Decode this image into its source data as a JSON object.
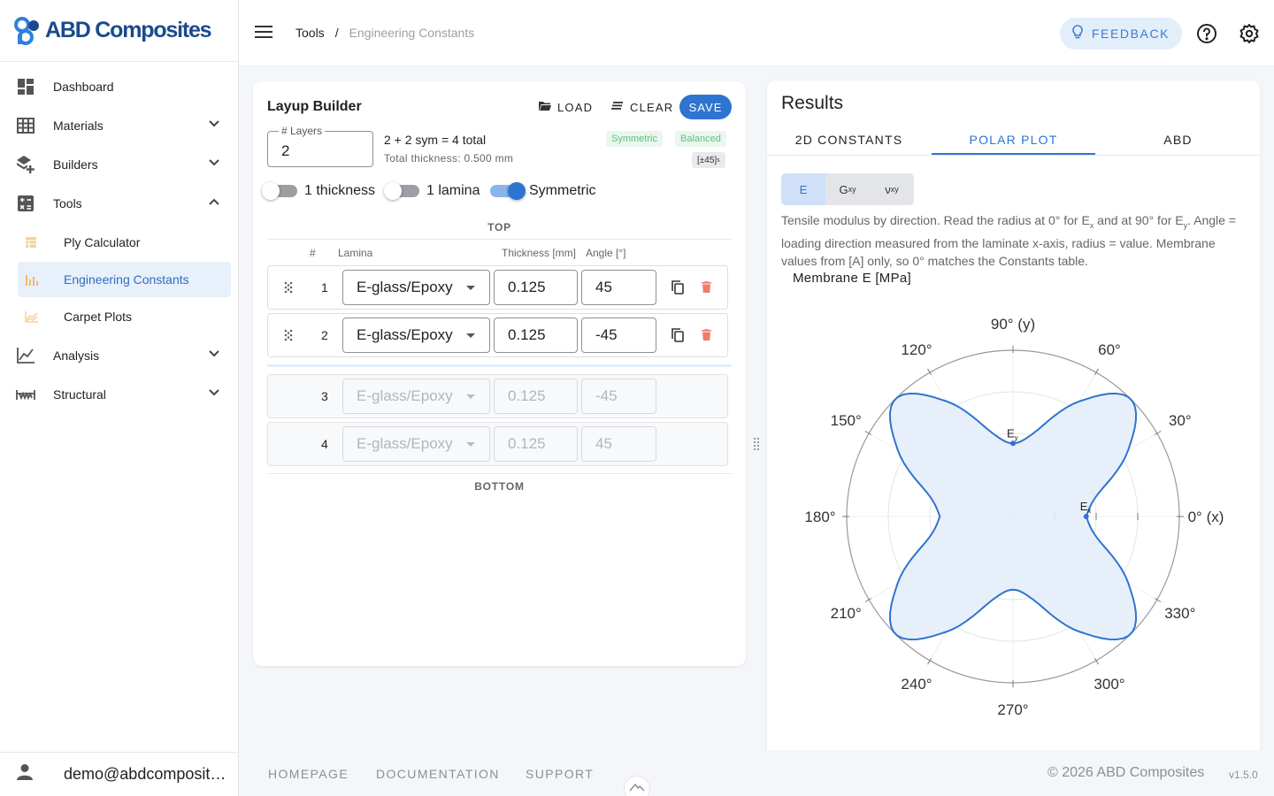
{
  "app": {
    "brand": "ABD Composites"
  },
  "sidebar": {
    "items": [
      {
        "label": "Dashboard",
        "icon": "dashboard-icon"
      },
      {
        "label": "Materials",
        "icon": "grid-icon"
      },
      {
        "label": "Builders",
        "icon": "layers-add-icon"
      },
      {
        "label": "Tools",
        "icon": "calculator-icon"
      },
      {
        "label": "Analysis",
        "icon": "line-chart-icon"
      },
      {
        "label": "Structural",
        "icon": "beam-icon"
      }
    ],
    "tools_sub": [
      {
        "label": "Ply Calculator",
        "icon": "table-icon"
      },
      {
        "label": "Engineering Constants",
        "icon": "bar-chart-icon"
      },
      {
        "label": "Carpet Plots",
        "icon": "area-chart-icon"
      }
    ],
    "user": "demo@abdcomposites.com"
  },
  "header": {
    "breadcrumb": [
      "Tools",
      "/",
      "Engineering Constants"
    ],
    "feedback": "FEEDBACK"
  },
  "layup": {
    "title": "Layup Builder",
    "load": "LOAD",
    "clear": "CLEAR",
    "save": "SAVE",
    "layers_label": "# Layers",
    "layers_value": "2",
    "summary": "2 + 2 sym = 4 total",
    "thickness": "Total thickness: 0.500 mm",
    "badges": [
      "Symmetric",
      "Balanced"
    ],
    "code_main": "[±45]",
    "code_sub": "s",
    "toggles": [
      {
        "label": "1 thickness",
        "on": false
      },
      {
        "label": "1 lamina",
        "on": false
      },
      {
        "label": "Symmetric",
        "on": true
      }
    ],
    "top": "TOP",
    "bottom": "BOTTOM",
    "columns": {
      "num": "#",
      "lamina": "Lamina",
      "thickness": "Thickness [mm]",
      "angle": "Angle [°]"
    },
    "plies": [
      {
        "n": "1",
        "material": "E-glass/Epoxy",
        "thickness": "0.125",
        "angle": "45"
      },
      {
        "n": "2",
        "material": "E-glass/Epoxy",
        "thickness": "0.125",
        "angle": "-45"
      },
      {
        "n": "3",
        "material": "E-glass/Epoxy",
        "thickness": "0.125",
        "angle": "-45"
      },
      {
        "n": "4",
        "material": "E-glass/Epoxy",
        "thickness": "0.125",
        "angle": "45"
      }
    ]
  },
  "results": {
    "title": "Results",
    "tabs": [
      "2D CONSTANTS",
      "POLAR PLOT",
      "ABD"
    ],
    "active_tab": 1,
    "modes": [
      {
        "main": "E",
        "sub": ""
      },
      {
        "main": "G",
        "sub": "xy"
      },
      {
        "main": "ν",
        "sub": "xy"
      }
    ],
    "desc": {
      "p1": "Tensile modulus by direction. Read the radius at 0° for E",
      "s1": "x",
      "p2": " and at 90° for E",
      "s2": "y",
      "p3": ". Angle = loading direction measured from the laminate x-axis, radius = value. Membrane values from [A] only, so 0° matches the Constants table."
    },
    "plot_title": "Membrane E [MPa]"
  },
  "chart_data": {
    "type": "polar",
    "title": "Membrane E [MPa]",
    "theta_unit": "deg",
    "angle_labels": [
      "0° (x)",
      "30°",
      "60°",
      "90° (y)",
      "120°",
      "150°",
      "180°",
      "210°",
      "240°",
      "270°",
      "300°",
      "330°"
    ],
    "angles": [
      0,
      15,
      30,
      45,
      60,
      75,
      90,
      105,
      120,
      135,
      150,
      165,
      180
    ],
    "r_relative": [
      0.44,
      0.53,
      0.8,
      1.0,
      0.8,
      0.53,
      0.44,
      0.53,
      0.8,
      1.0,
      0.8,
      0.53,
      0.44
    ],
    "rings": 4,
    "markers": [
      {
        "label": "E",
        "sub": "x",
        "angle": 0,
        "r_relative": 0.44
      },
      {
        "label": "E",
        "sub": "y",
        "angle": 90,
        "r_relative": 0.44
      }
    ],
    "series_color": "#2f74d0",
    "fill_color": "#e3edf9"
  },
  "footer": {
    "links": [
      "HOMEPAGE",
      "DOCUMENTATION",
      "SUPPORT"
    ],
    "copyright": "© 2026 ABD Composites",
    "version": "v1.5.0"
  }
}
